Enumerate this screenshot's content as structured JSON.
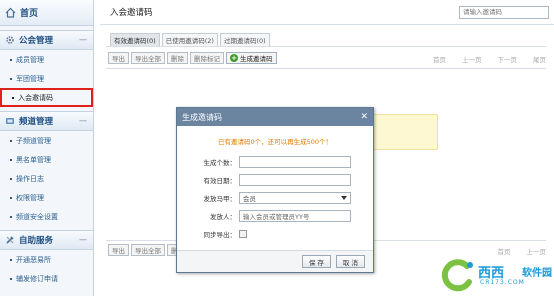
{
  "sidebar": {
    "home_label": "首页",
    "sections": [
      {
        "label": "公会管理",
        "collapse": "一",
        "items": [
          "成员管理",
          "军团管理",
          "入会邀请码"
        ]
      },
      {
        "label": "频道管理",
        "collapse": "一",
        "items": [
          "子频道管理",
          "黑名单管理",
          "操作日志",
          "权限管理",
          "频道安全设置"
        ]
      },
      {
        "label": "自助服务",
        "collapse": "一",
        "items": [
          "开通恶易所",
          "辅发修订申请"
        ]
      }
    ],
    "active_item": "入会邀请码"
  },
  "header": {
    "title": "入会邀请码",
    "search_placeholder": "请输入邀请码"
  },
  "tabs": [
    "有效邀请码(0)",
    "已使用邀请码(2)",
    "过期邀请码(0)"
  ],
  "toolbar": {
    "export": "导出",
    "export_all": "导出全部",
    "delete": "删除",
    "delete_flag": "删除标记",
    "generate": "生成邀请码"
  },
  "pager": {
    "first": "首页",
    "prev": "上一页",
    "next": "下一页",
    "last": "尾页"
  },
  "dialog": {
    "title": "生成邀请码",
    "close": "✕",
    "notice": "已有邀请码0个，还可以再生成500个！",
    "fields": {
      "count_label": "生成个数：",
      "expiry_label": "有效日期：",
      "send_label": "发放马甲：",
      "send_value": "会员",
      "issuer_label": "发放人：",
      "issuer_placeholder": "输入会员或管理员YY号",
      "sync_label": "同步导出："
    },
    "save": "保 存",
    "cancel": "取 消"
  },
  "watermark": {
    "brand": "西西",
    "suffix": "软件园",
    "url": "CR173.COM"
  },
  "colors": {
    "accent": "#6b84a0",
    "active_outline": "#e0201b",
    "notice": "#e07b00",
    "brand": "#1c9bd8"
  }
}
